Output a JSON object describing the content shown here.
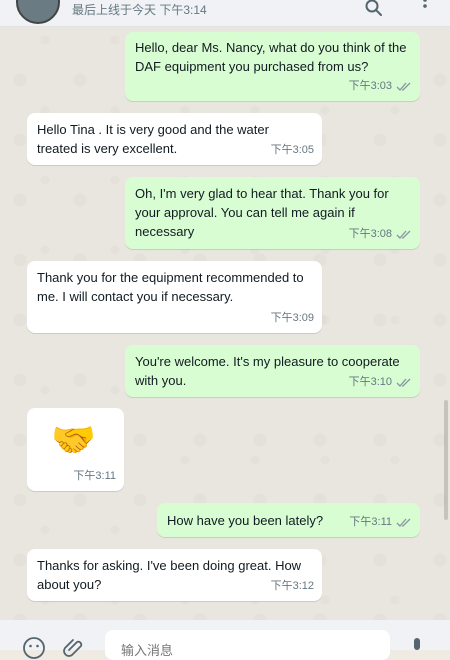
{
  "header": {
    "status": "最后上线于今天 下午3:14"
  },
  "messages": [
    {
      "dir": "out",
      "text": "Hello, dear Ms. Nancy, what do you think of the DAF equipment you purchased from us?",
      "time": "下午3:03"
    },
    {
      "dir": "in",
      "text": "Hello Tina . It is very good and the water treated is very excellent.",
      "time": "下午3:05"
    },
    {
      "dir": "out",
      "text": "Oh, I'm very glad to hear that. Thank you for your approval. You can tell me again if necessary",
      "time": "下午3:08"
    },
    {
      "dir": "in",
      "text": "Thank you for the equipment recommended to me. I will contact you if necessary.",
      "time": "下午3:09"
    },
    {
      "dir": "out",
      "text": "You're welcome. It's my pleasure to cooperate with you.",
      "time": "下午3:10"
    },
    {
      "dir": "in",
      "emoji": "🤝",
      "time": "下午3:11"
    },
    {
      "dir": "out",
      "text": "How have you been lately?",
      "time": "下午3:11"
    },
    {
      "dir": "in",
      "text": "Thanks for asking. I've been doing great. How about you?",
      "time": "下午3:12"
    }
  ],
  "composer": {
    "placeholder": "输入消息"
  },
  "icons": {
    "search": "search-icon",
    "menu": "menu-icon",
    "emoji": "emoji-icon",
    "attach": "attach-icon",
    "mic": "microphone-icon",
    "read": "double-check-icon"
  },
  "colors": {
    "outgoing": "#d9fdd3",
    "incoming": "#ffffff",
    "read_tick": "#8696a0"
  }
}
